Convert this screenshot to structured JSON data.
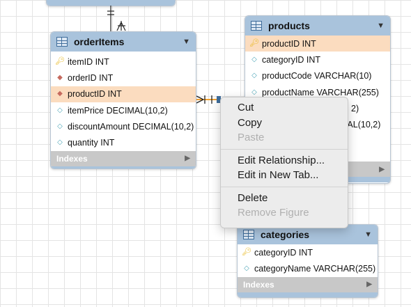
{
  "tables": {
    "orderItems": {
      "title": "orderItems",
      "rows": [
        {
          "text": "itemID INT",
          "kind": "pk-icon"
        },
        {
          "text": "orderID INT",
          "kind": "fk-icon"
        },
        {
          "text": "productID INT",
          "kind": "fk-icon",
          "selected": true
        },
        {
          "text": "itemPrice DECIMAL(10,2)",
          "kind": "column-icon"
        },
        {
          "text": "discountAmount DECIMAL(10,2)",
          "kind": "column-icon"
        },
        {
          "text": "quantity INT",
          "kind": "column-icon"
        }
      ],
      "footer": "Indexes"
    },
    "products": {
      "title": "products",
      "rows": [
        {
          "text": "productID INT",
          "kind": "pk-icon",
          "selected": true
        },
        {
          "text": "categoryID INT",
          "kind": "column-icon"
        },
        {
          "text": "productCode VARCHAR(10)",
          "kind": "column-icon"
        },
        {
          "text": "productName VARCHAR(255)",
          "kind": "column-icon"
        },
        {
          "text": "2)",
          "kind": "hidden"
        },
        {
          "text": "MAL(10,2)",
          "kind": "hidden"
        }
      ]
    },
    "categories": {
      "title": "categories",
      "rows": [
        {
          "text": "categoryID INT",
          "kind": "pk-icon"
        },
        {
          "text": "categoryName VARCHAR(255)",
          "kind": "column-icon"
        }
      ],
      "footer": "Indexes"
    }
  },
  "context_menu": {
    "items": [
      {
        "label": "Cut",
        "enabled": true
      },
      {
        "label": "Copy",
        "enabled": true
      },
      {
        "label": "Paste",
        "enabled": false
      },
      {
        "label": "Edit Relationship...",
        "enabled": true
      },
      {
        "label": "Edit in New Tab...",
        "enabled": true
      },
      {
        "label": "Delete",
        "enabled": true
      },
      {
        "label": "Remove Figure",
        "enabled": false
      }
    ]
  },
  "colors": {
    "header": "#a9c3dc",
    "selected_row": "#fbdcbf",
    "relationship_line": "#f0a030",
    "footer": "#c8c8c8"
  }
}
